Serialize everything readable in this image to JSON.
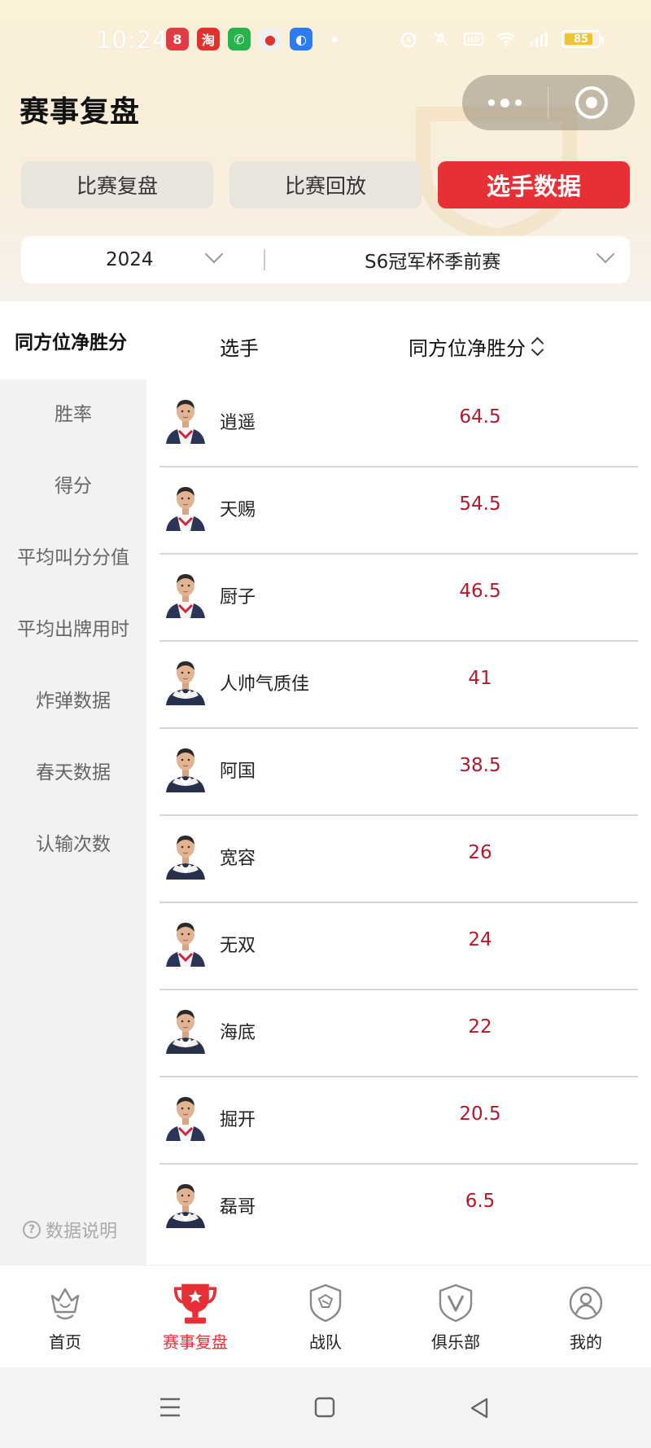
{
  "status_bar": {
    "time": "10:24",
    "battery": "85",
    "apps": [
      {
        "icon": "game-app-icon",
        "glyph": "8",
        "color": "#e23b46"
      },
      {
        "icon": "taobao-app-icon",
        "glyph": "淘",
        "color": "#e0332e"
      },
      {
        "icon": "phone-app-icon",
        "glyph": "✆",
        "color": "#27b24a"
      },
      {
        "icon": "map-app-icon",
        "glyph": "●",
        "color": "#f0f0f0"
      },
      {
        "icon": "browser-app-icon",
        "glyph": "◐",
        "color": "#2d7bf0"
      }
    ]
  },
  "header": {
    "title": "赛事复盘"
  },
  "tabs": [
    {
      "label": "比赛复盘",
      "active": false
    },
    {
      "label": "比赛回放",
      "active": false
    },
    {
      "label": "选手数据",
      "active": true
    }
  ],
  "filters": {
    "year": "2024",
    "season": "S6冠军杯季前赛"
  },
  "sidebar": {
    "items": [
      {
        "label": "同方位净胜分",
        "active": true
      },
      {
        "label": "胜率",
        "active": false
      },
      {
        "label": "得分",
        "active": false
      },
      {
        "label": "平均叫分分值",
        "active": false
      },
      {
        "label": "平均出牌用时",
        "active": false
      },
      {
        "label": "炸弹数据",
        "active": false
      },
      {
        "label": "春天数据",
        "active": false
      },
      {
        "label": "认输次数",
        "active": false
      }
    ],
    "help_label": "数据说明"
  },
  "table": {
    "col_player": "选手",
    "col_score": "同方位净胜分",
    "rows": [
      {
        "name": "逍遥",
        "score": "64.5",
        "jersey": "red"
      },
      {
        "name": "天赐",
        "score": "54.5",
        "jersey": "red"
      },
      {
        "name": "厨子",
        "score": "46.5",
        "jersey": "red"
      },
      {
        "name": "人帅气质佳",
        "score": "41",
        "jersey": "dark"
      },
      {
        "name": "阿国",
        "score": "38.5",
        "jersey": "dark"
      },
      {
        "name": "宽容",
        "score": "26",
        "jersey": "dark"
      },
      {
        "name": "无双",
        "score": "24",
        "jersey": "red"
      },
      {
        "name": "海底",
        "score": "22",
        "jersey": "dark"
      },
      {
        "name": "掘开",
        "score": "20.5",
        "jersey": "red"
      },
      {
        "name": "磊哥",
        "score": "6.5",
        "jersey": "dark"
      }
    ]
  },
  "bottom_nav": [
    {
      "label": "首页",
      "icon": "crown-home-icon",
      "active": false
    },
    {
      "label": "赛事复盘",
      "icon": "trophy-icon",
      "active": true
    },
    {
      "label": "战队",
      "icon": "shield-team-icon",
      "active": false
    },
    {
      "label": "俱乐部",
      "icon": "v-badge-club-icon",
      "active": false
    },
    {
      "label": "我的",
      "icon": "user-profile-icon",
      "active": false
    }
  ],
  "colors": {
    "accent": "#e73035",
    "score": "#b5182a",
    "sidebar_bg": "#f2f2f2"
  }
}
